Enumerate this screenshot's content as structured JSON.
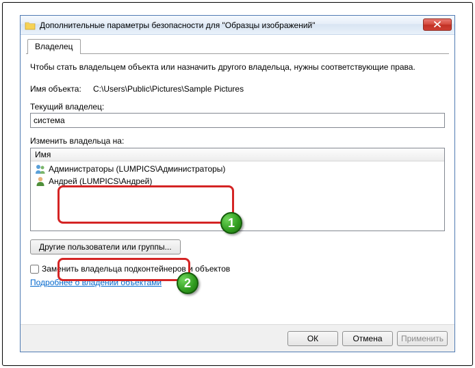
{
  "window": {
    "title": "Дополнительные параметры безопасности  для \"Образцы изображений\""
  },
  "tabs": {
    "owner": "Владелец"
  },
  "content": {
    "description": "Чтобы стать владельцем объекта или назначить другого владельца, нужны соответствующие права.",
    "object_name_label": "Имя объекта:",
    "object_name_value": "C:\\Users\\Public\\Pictures\\Sample Pictures",
    "current_owner_label": "Текущий владелец:",
    "current_owner_value": "система",
    "change_owner_label": "Изменить владельца на:",
    "list_header": "Имя",
    "owners": [
      "Администраторы (LUMPICS\\Администраторы)",
      "Андрей (LUMPICS\\Андрей)"
    ],
    "other_users_button": "Другие пользователи или группы...",
    "replace_owner_checkbox": "Заменить владельца подконтейнеров и объектов",
    "learn_more_link": "Подробнее о владении объектами"
  },
  "buttons": {
    "ok": "ОК",
    "cancel": "Отмена",
    "apply": "Применить"
  },
  "callouts": {
    "one": "1",
    "two": "2"
  }
}
